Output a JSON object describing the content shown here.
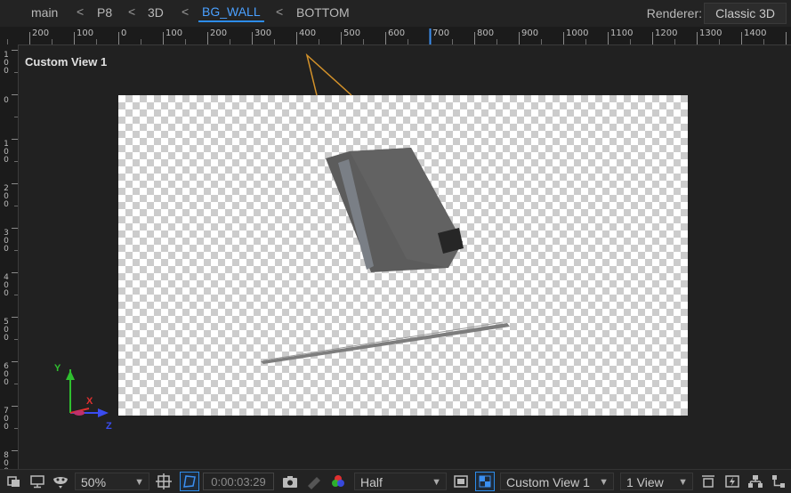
{
  "breadcrumbs": {
    "items": [
      "main",
      "P8",
      "3D",
      "BG_WALL",
      "BOTTOM"
    ],
    "chevron": "<"
  },
  "renderer": {
    "label": "Renderer:",
    "value": "Classic 3D"
  },
  "ruler": {
    "h_labels": [
      "200",
      "100",
      "0",
      "100",
      "200",
      "300",
      "400",
      "500",
      "600",
      "700",
      "800",
      "900",
      "1000",
      "1100",
      "1200",
      "1300",
      "1400"
    ],
    "v_labels": [
      "100",
      "0",
      "100",
      "200",
      "300",
      "400",
      "500",
      "600",
      "700",
      "800"
    ]
  },
  "viewport": {
    "title": "Custom View 1"
  },
  "axes": {
    "x": "X",
    "y": "Y",
    "z": "Z"
  },
  "toolbar": {
    "magnification": "50%",
    "timecode": "0:00:03:29",
    "resolution": "Half",
    "view_layout_view": "Custom View 1",
    "view_count": "1 View"
  },
  "colors": {
    "accent": "#2d8ceb",
    "axis_x": "#e03030",
    "axis_y": "#2fbf2f",
    "axis_z": "#3a4cf0"
  }
}
